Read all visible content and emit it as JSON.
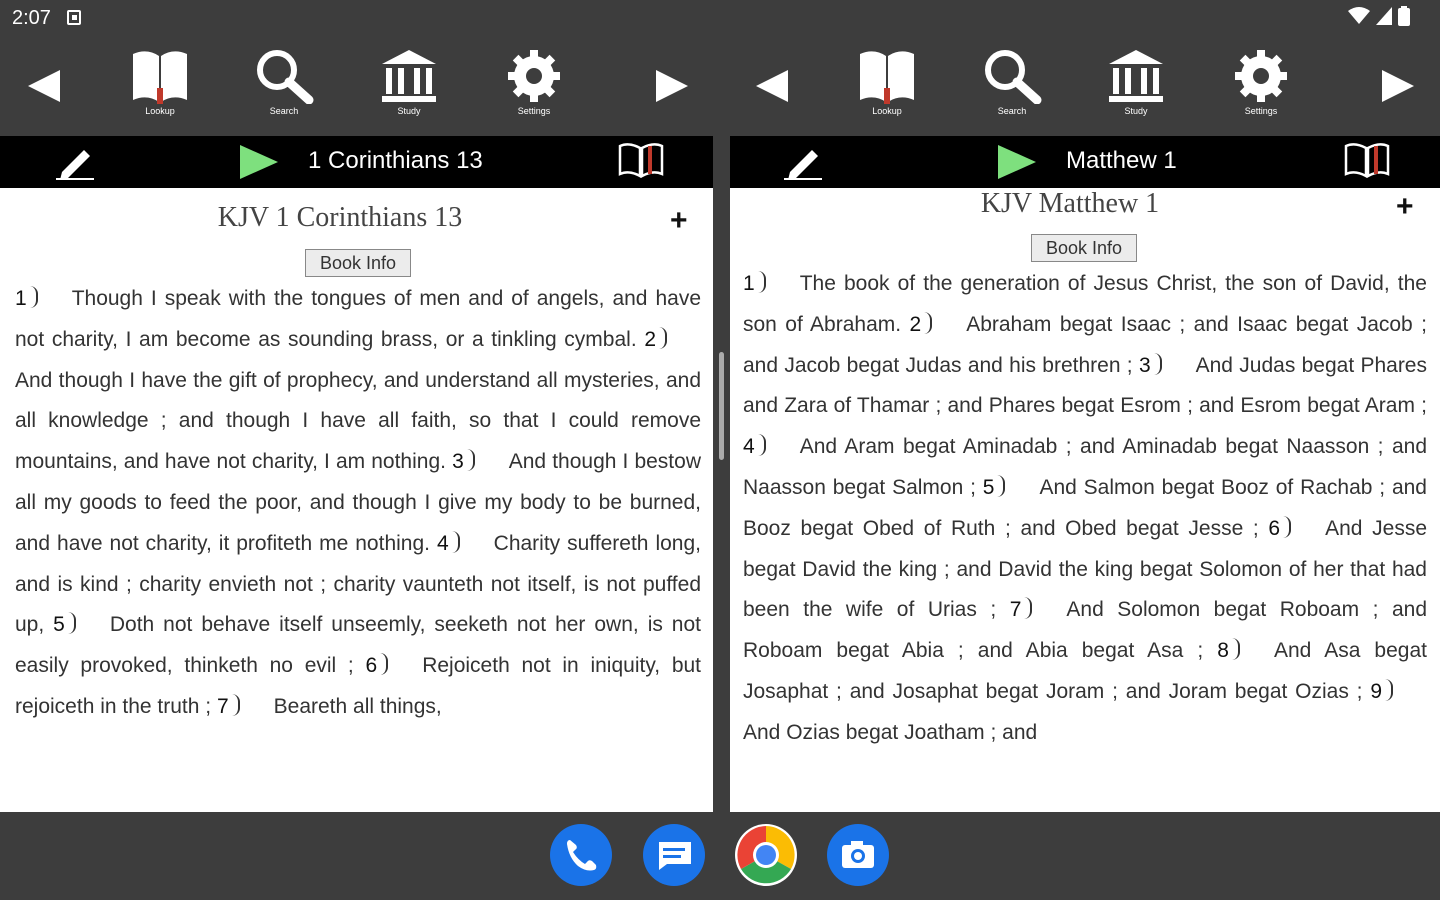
{
  "status": {
    "time": "2:07"
  },
  "left": {
    "toolbar": {
      "lookup": "Lookup",
      "search": "Search",
      "study": "Study",
      "settings": "Settings"
    },
    "nav_title": "1 Corinthians 13",
    "heading": "KJV 1 Corinthians 13",
    "book_info": "Book Info",
    "plus": "+",
    "verses": [
      {
        "n": "1",
        "t": "Though I speak with the tongues of men and of angels, and have not charity, I am become as sounding brass, or a tinkling cymbal."
      },
      {
        "n": "2",
        "t": "And though I have the gift of prophecy, and understand all mysteries, and all knowledge ; and though I have all faith, so that I could remove mountains, and have not charity, I am nothing."
      },
      {
        "n": "3",
        "t": "And though I bestow all my goods to feed the poor, and though I give my body to be burned, and have not charity, it profiteth me nothing."
      },
      {
        "n": "4",
        "t": "Charity suffereth long, and is kind ; charity envieth not ; charity vaunteth not itself, is not puffed up,"
      },
      {
        "n": "5",
        "t": "Doth not behave itself unseemly, seeketh not her own, is not easily provoked, thinketh no evil ;"
      },
      {
        "n": "6",
        "t": "Rejoiceth not in iniquity, but rejoiceth in the truth ;"
      },
      {
        "n": "7",
        "t": "Beareth all things,"
      }
    ]
  },
  "right": {
    "toolbar": {
      "lookup": "Lookup",
      "search": "Search",
      "study": "Study",
      "settings": "Settings"
    },
    "nav_title": "Matthew 1",
    "heading": "KJV Matthew 1",
    "book_info": "Book Info",
    "plus": "+",
    "verses": [
      {
        "n": "1",
        "t": "The book of the generation of Jesus Christ, the son of David, the son of Abraham."
      },
      {
        "n": "2",
        "t": "Abraham begat Isaac ; and Isaac begat Jacob ; and Jacob begat Judas and his brethren ;"
      },
      {
        "n": "3",
        "t": "And Judas begat Phares and Zara of Thamar ; and Phares begat Esrom ; and Esrom begat Aram ;"
      },
      {
        "n": "4",
        "t": "And Aram begat Aminadab ; and Aminadab begat Naasson ; and Naasson begat Salmon ;"
      },
      {
        "n": "5",
        "t": "And Salmon begat Booz of Rachab ; and Booz begat Obed of Ruth ; and Obed begat Jesse ;"
      },
      {
        "n": "6",
        "t": "And Jesse begat David the king ; and David the king begat Solomon of her that had been the wife of Urias ;"
      },
      {
        "n": "7",
        "t": "And Solomon begat Roboam ; and Roboam begat Abia ; and Abia begat Asa ;"
      },
      {
        "n": "8",
        "t": "And Asa begat Josaphat ; and Josaphat begat Joram ; and Joram begat Ozias ;"
      },
      {
        "n": "9",
        "t": "And Ozias begat Joatham ; and"
      }
    ]
  },
  "dock": [
    "phone-icon",
    "messages-icon",
    "chrome-icon",
    "camera-icon"
  ]
}
